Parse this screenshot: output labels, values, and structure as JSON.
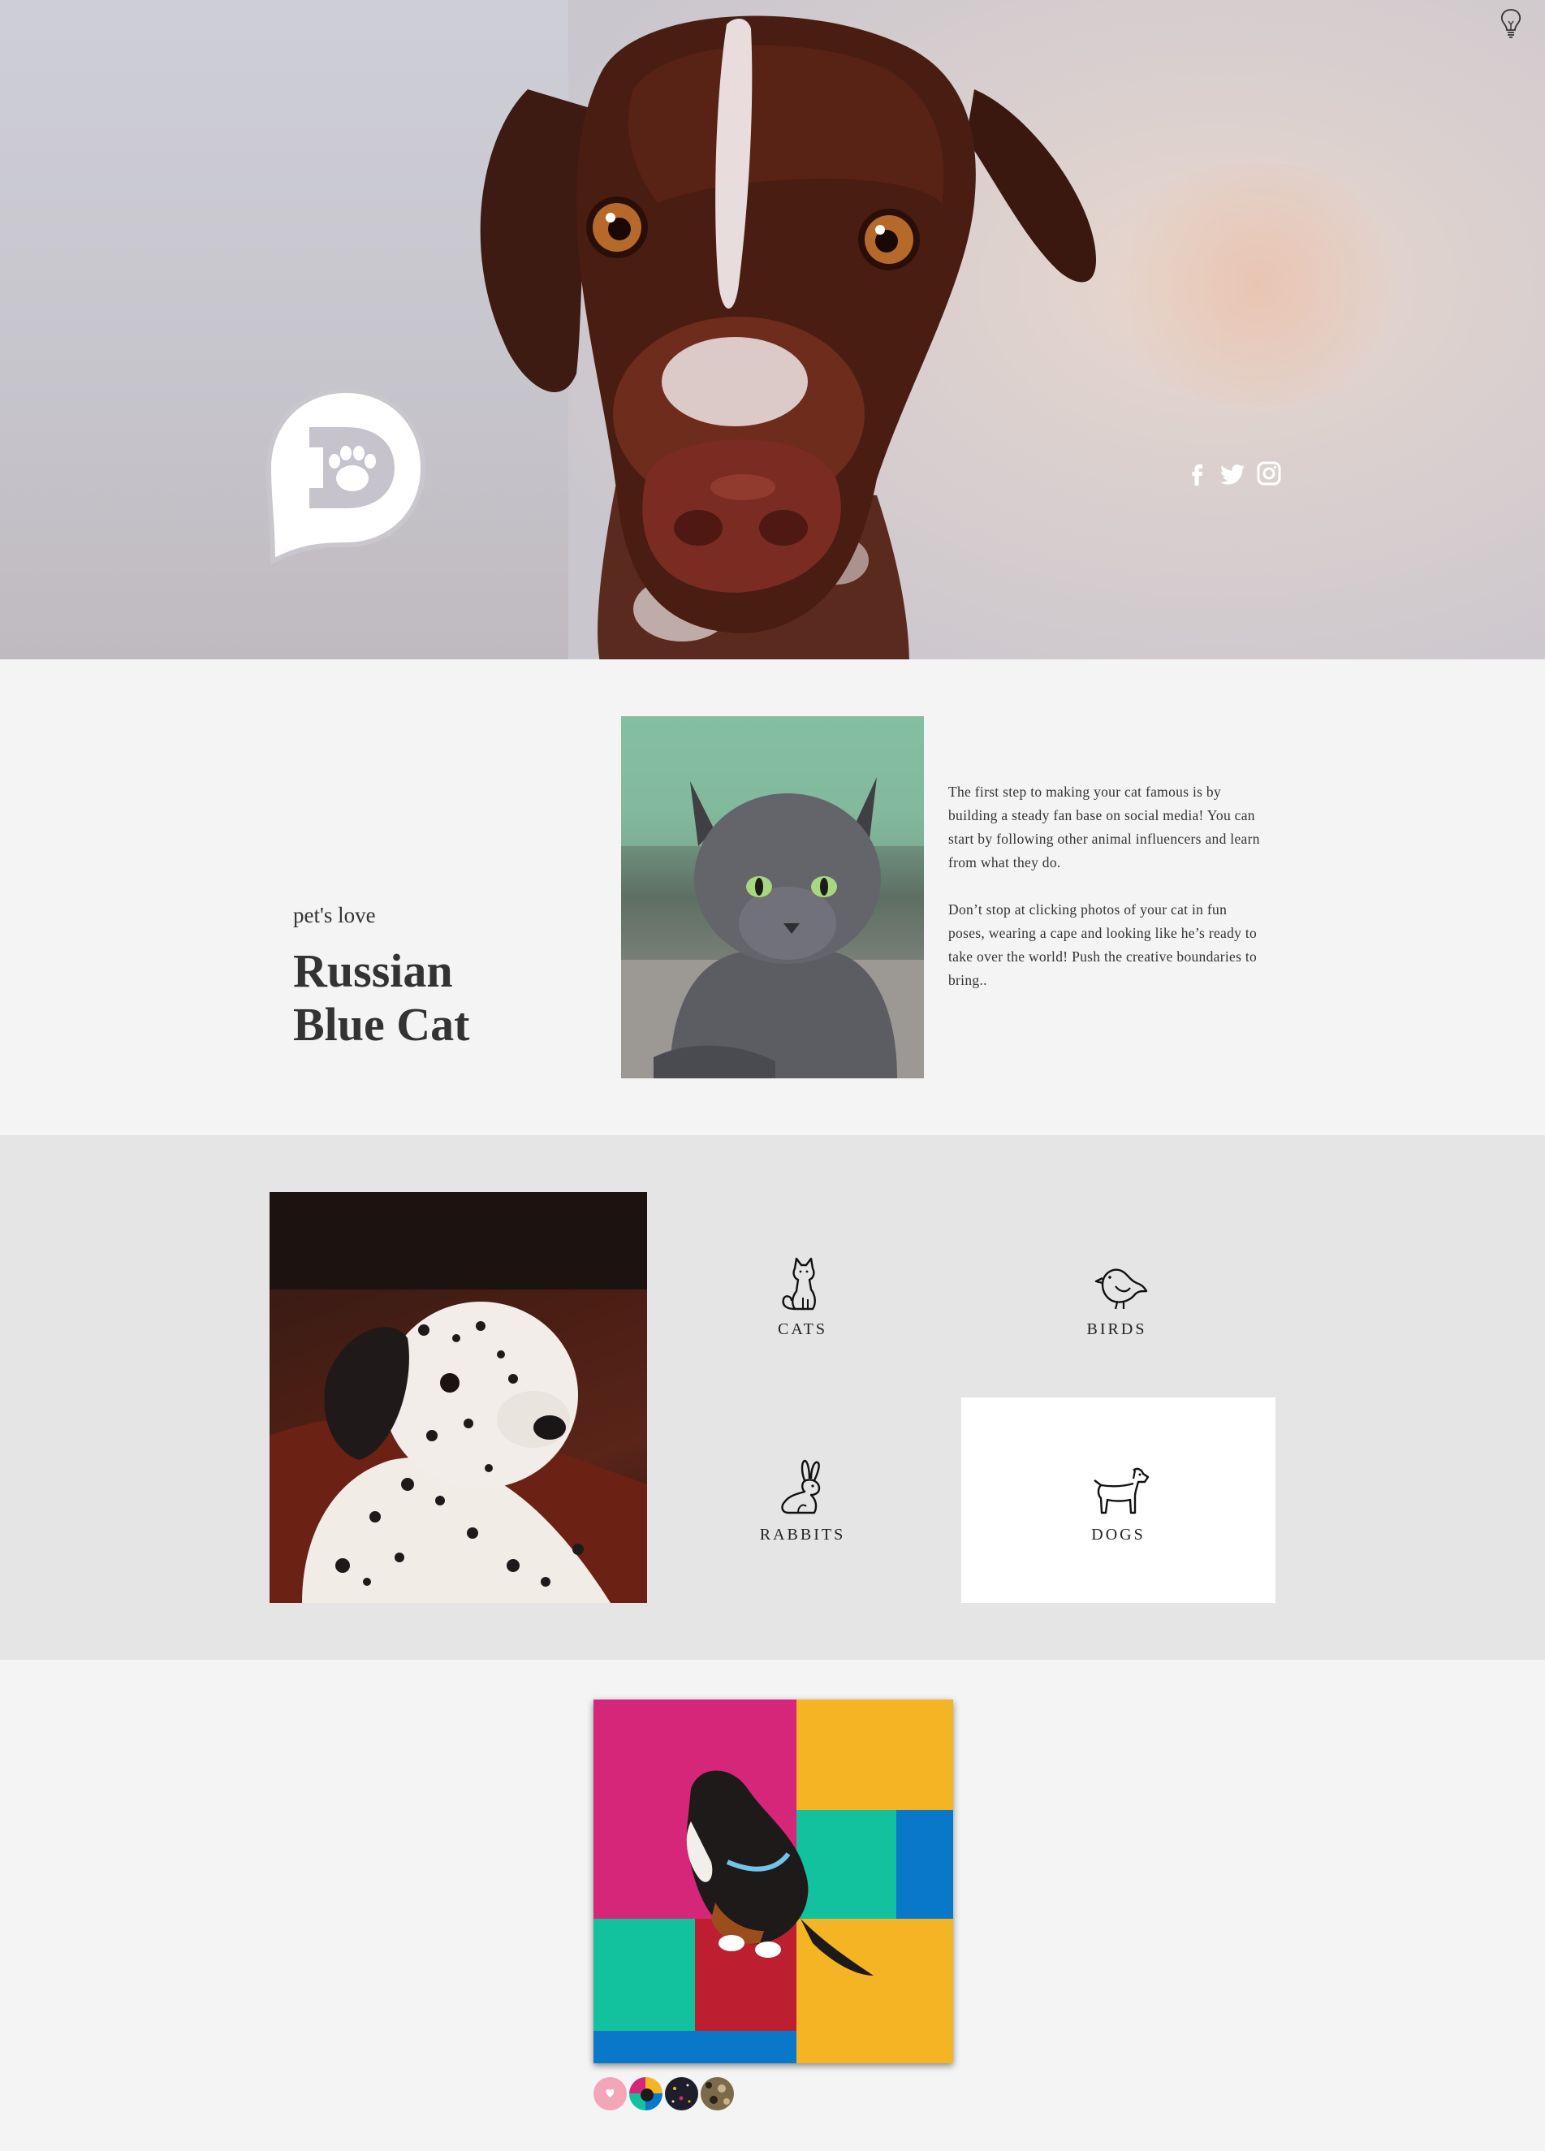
{
  "header": {
    "lightbulb_icon": "lightbulb-icon",
    "logo": {
      "letter": "D",
      "icon": "paw-icon"
    },
    "social": [
      {
        "name": "facebook",
        "icon": "facebook-icon"
      },
      {
        "name": "twitter",
        "icon": "twitter-icon"
      },
      {
        "name": "instagram",
        "icon": "instagram-icon"
      }
    ]
  },
  "about": {
    "kicker": "pet's love",
    "title_line1": "Russian",
    "title_line2": "Blue Cat",
    "paragraph1": "The first step to making your cat famous is by building a steady fan base on social media! You can start by following other animal influencers and learn from what they do.",
    "paragraph2": "Don’t stop at clicking photos of your cat in fun poses, wearing a cape and looking like he’s ready to take over the world! Push the creative boundaries to bring.."
  },
  "categories": {
    "items": [
      {
        "label": "CATS",
        "icon": "cat-icon"
      },
      {
        "label": "BIRDS",
        "icon": "bird-icon"
      },
      {
        "label": "RABBITS",
        "icon": "rabbit-icon"
      },
      {
        "label": "DOGS",
        "icon": "dog-icon",
        "selected": true
      }
    ]
  },
  "colors": {
    "page_bg": "#f4f4f4",
    "categories_bg": "#e5e5e5",
    "selected_tile": "#ffffff",
    "product_magenta": "#d6267a",
    "product_yellow": "#f5b423",
    "product_teal": "#12c19e",
    "product_blue": "#0a78c8",
    "product_red": "#bd1f30"
  }
}
